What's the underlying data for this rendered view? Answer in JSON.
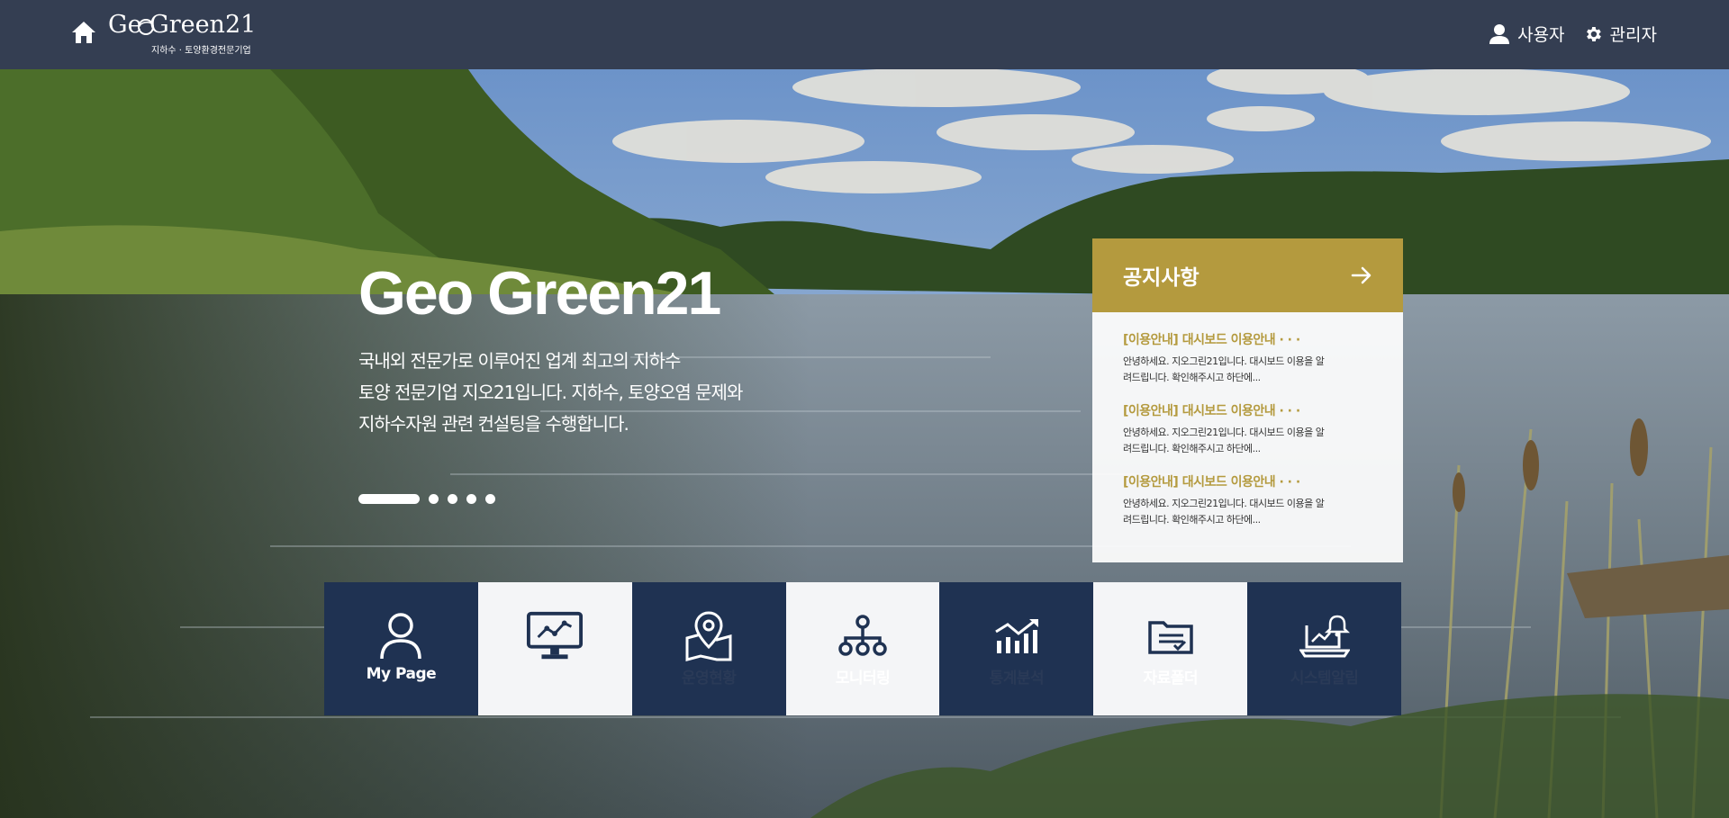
{
  "header": {
    "logo_main": "Ge  Green21",
    "logo_sub": "지하수 · 토양환경전문기업",
    "user_label": "사용자",
    "admin_label": "관리자"
  },
  "hero": {
    "title": "Geo Green21",
    "desc_line1": "국내외 전문가로 이루어진 업계 최고의 지하수",
    "desc_line2": "토양 전문기업 지오21입니다. 지하수, 토양오염 문제와",
    "desc_line3": "지하수자원 관련 컨설팅을 수행합니다."
  },
  "notice": {
    "title": "공지사항",
    "items": [
      {
        "title": "[이용안내] 대시보드 이용안내 · · ·",
        "text": "안녕하세요. 지오그린21입니다. 대시보드 이용을 알려드립니다. 확인해주시고 하단에..."
      },
      {
        "title": "[이용안내] 대시보드 이용안내 · · ·",
        "text": "안녕하세요. 지오그린21입니다. 대시보드 이용을 알려드립니다. 확인해주시고 하단에..."
      },
      {
        "title": "[이용안내] 대시보드 이용안내 · · ·",
        "text": "안녕하세요. 지오그린21입니다. 대시보드 이용을 알려드립니다. 확인해주시고 하단에..."
      }
    ]
  },
  "tiles": [
    {
      "label": "My Page",
      "icon": "user-icon"
    },
    {
      "label": "",
      "icon": "monitor-chart-icon"
    },
    {
      "label": "운영현황",
      "icon": "map-pin-icon"
    },
    {
      "label": "모니터링",
      "icon": "network-icon"
    },
    {
      "label": "통계분석",
      "icon": "trend-chart-icon"
    },
    {
      "label": "자료폴더",
      "icon": "folder-icon"
    },
    {
      "label": "시스템알림",
      "icon": "laptop-bell-icon"
    }
  ],
  "colors": {
    "header_bg": "#343e52",
    "accent_gold": "#b49a3e",
    "tile_dark": "#1f3252",
    "tile_light": "#f4f5f7"
  }
}
